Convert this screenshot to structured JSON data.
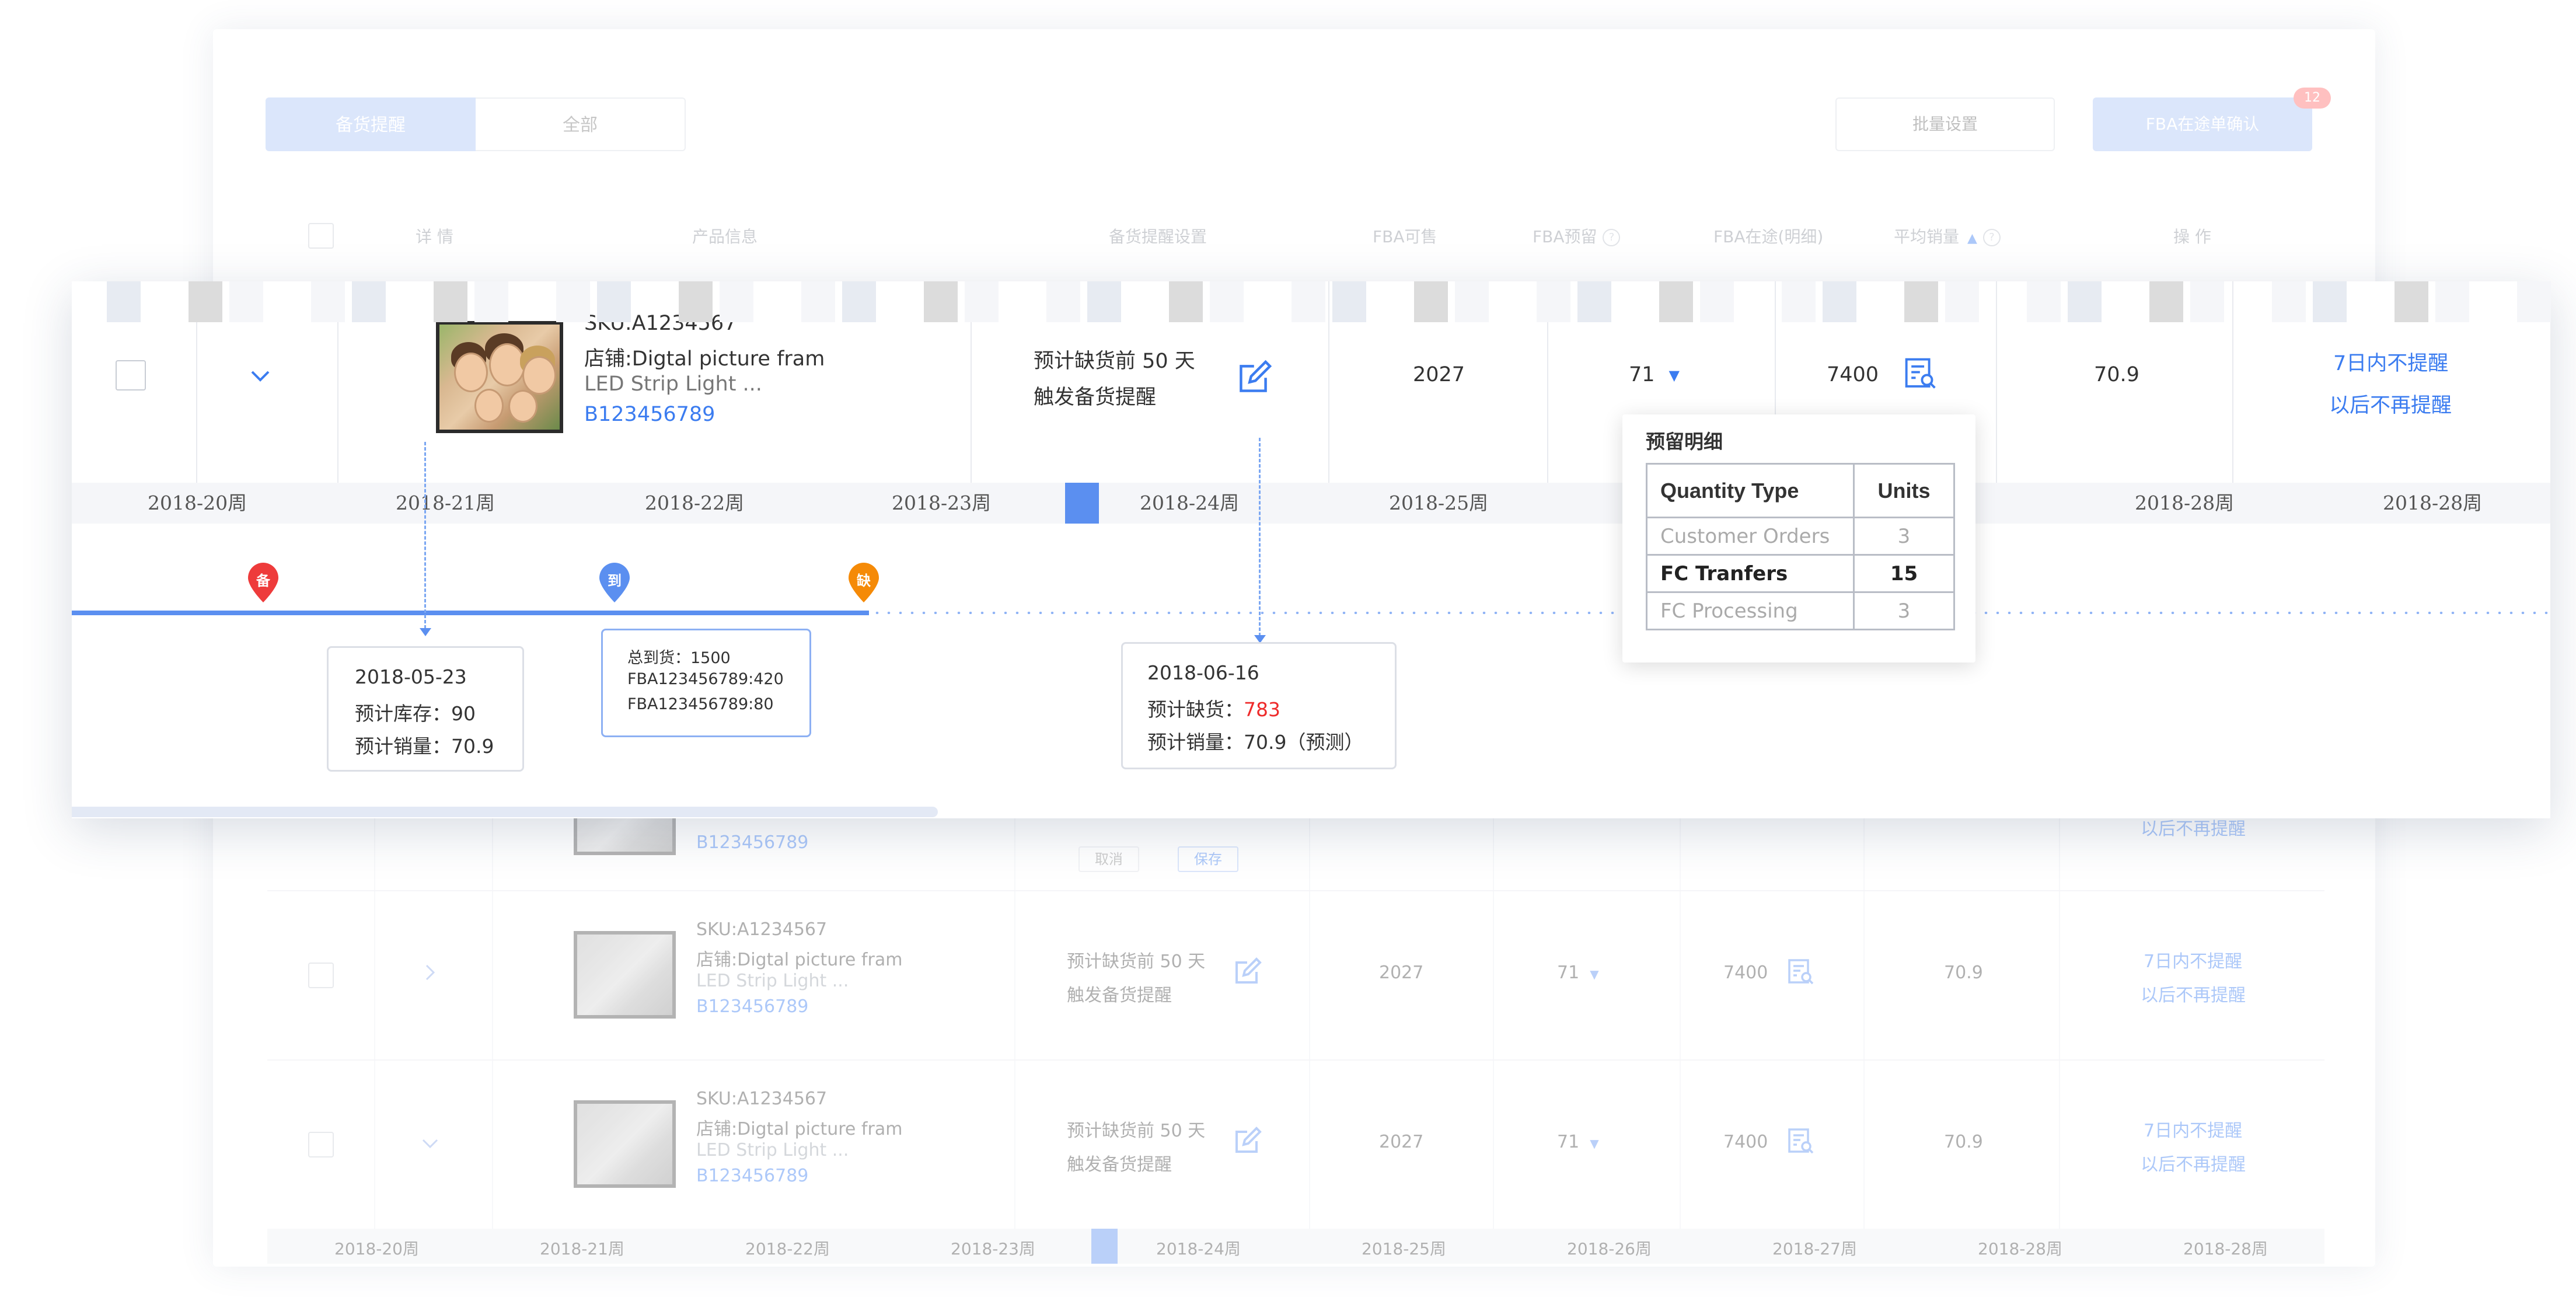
{
  "tabs": [
    {
      "label": "备货提醒",
      "active": true
    },
    {
      "label": "全部",
      "active": false
    }
  ],
  "toolbar": {
    "batch_label": "批量设置",
    "fba_confirm_label": "FBA在途单确认",
    "fba_badge": "12"
  },
  "table_headers": {
    "detail": "详 情",
    "product": "产品信息",
    "reminder": "备货提醒设置",
    "fba_available": "FBA可售",
    "fba_reserved": "FBA预留",
    "fba_inbound": "FBA在途(明细)",
    "avg_sales": "平均销量",
    "actions": "操 作"
  },
  "expanded_row": {
    "sku": "SKU:A1234567",
    "store": "店铺:Digtal picture fram",
    "product_name": "LED Strip Light ...",
    "asin": "B123456789",
    "reminder_line1": "预计缺货前 50 天",
    "reminder_line2": "触发备货提醒",
    "fba_available": "2027",
    "fba_reserved": "71",
    "fba_inbound": "7400",
    "avg_sales": "70.9",
    "action1": "7日内不提醒",
    "action2": "以后不再提醒"
  },
  "weeks": [
    "2018-20周",
    "2018-21周",
    "2018-22周",
    "2018-23周",
    "2018-24周",
    "2018-25周",
    "2018-28周",
    "2018-28周"
  ],
  "pins": {
    "stock": "备",
    "arrival": "到",
    "shortage": "缺"
  },
  "box_inventory": {
    "date": "2018-05-23",
    "line1": "预计库存：90",
    "line2": "预计销量：70.9"
  },
  "box_arrival": {
    "line1": "总到货：1500",
    "line2": "FBA123456789:420",
    "line3": "FBA123456789:80"
  },
  "box_shortage": {
    "date": "2018-06-16",
    "shortage_label": "预计缺货：",
    "shortage_value": "783",
    "line2": "预计销量：70.9（预测）"
  },
  "reserve_popover": {
    "title": "预留明细",
    "col_type": "Quantity Type",
    "col_units": "Units",
    "rows": [
      {
        "type": "Customer Orders",
        "units": "3"
      },
      {
        "type": "FC Tranfers",
        "units": "15"
      },
      {
        "type": "FC Processing",
        "units": "3"
      }
    ]
  },
  "faded_rows": {
    "row0_action": "以后不再提醒",
    "row0_asin": "B123456789",
    "row0_cancel": "取消",
    "row0_save": "保存",
    "sku": "SKU:A1234567",
    "store": "店铺:Digtal picture fram",
    "product_name": "LED Strip Light ...",
    "asin": "B123456789",
    "reminder_line1": "预计缺货前 50 天",
    "reminder_line2": "触发备货提醒",
    "fba_available": "2027",
    "fba_reserved": "71",
    "fba_inbound": "7400",
    "avg_sales": "70.9",
    "action1": "7日内不提醒",
    "action2": "以后不再提醒"
  },
  "bottom_weeks": [
    "2018-20周",
    "2018-21周",
    "2018-22周",
    "2018-23周",
    "2018-24周",
    "2018-25周",
    "2018-26周",
    "2018-27周",
    "2018-28周",
    "2018-28周"
  ],
  "colors": {
    "accent": "#3b7cf0",
    "pin_red": "#ee3b3b",
    "pin_blue": "#5b8ff0",
    "pin_orange": "#f58a07",
    "shortage_red": "#ee2b2b"
  }
}
